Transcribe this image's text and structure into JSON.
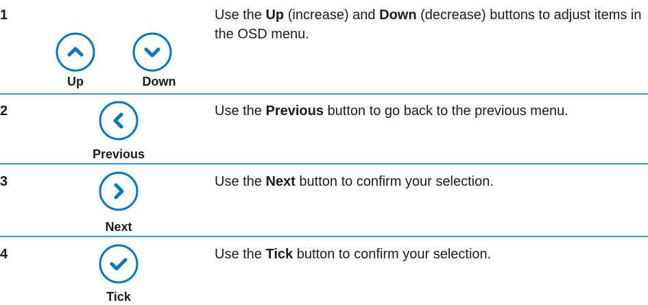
{
  "accent_color": "#0077c8",
  "divider_color": "#2a9fd8",
  "rows": [
    {
      "number": "1",
      "buttons": [
        {
          "label": "Up",
          "icon": "chevron-up-icon"
        },
        {
          "label": "Down",
          "icon": "chevron-down-icon"
        }
      ],
      "desc": {
        "pre": "Use the ",
        "b1": "Up",
        "mid1": " (increase) and ",
        "b2": "Down",
        "post": " (decrease) buttons to adjust items in the OSD menu."
      }
    },
    {
      "number": "2",
      "buttons": [
        {
          "label": "Previous",
          "icon": "chevron-left-icon"
        }
      ],
      "desc": {
        "pre": "Use the ",
        "b1": "Previous",
        "post": " button to go back to the previous menu."
      }
    },
    {
      "number": "3",
      "buttons": [
        {
          "label": "Next",
          "icon": "chevron-right-icon"
        }
      ],
      "desc": {
        "pre": "Use the ",
        "b1": "Next",
        "post": " button to confirm your selection."
      }
    },
    {
      "number": "4",
      "buttons": [
        {
          "label": "Tick",
          "icon": "checkmark-icon"
        }
      ],
      "desc": {
        "pre": "Use the ",
        "b1": "Tick",
        "post": " button to confirm your selection."
      }
    }
  ]
}
